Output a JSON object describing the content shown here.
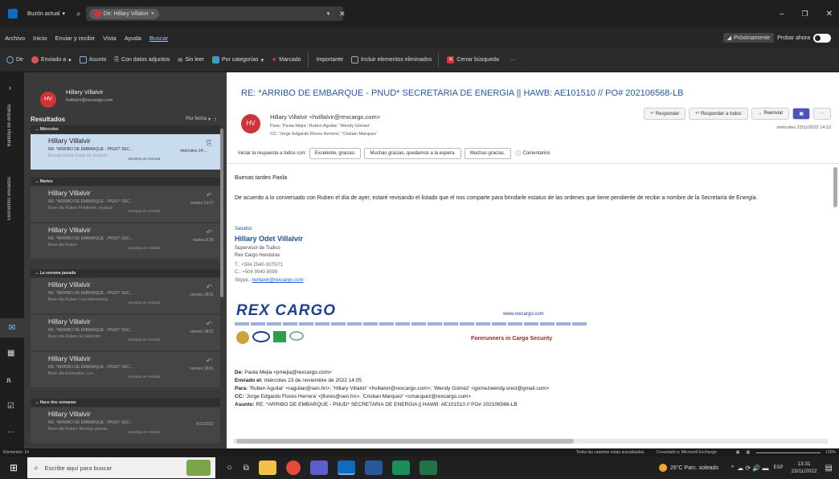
{
  "titlebar": {
    "mailbox": "Buzón actual",
    "search_tab": "De: Hillary Villalvir"
  },
  "menu": [
    "Archivo",
    "Inicio",
    "Enviar y recibir",
    "Vista",
    "Ayuda",
    "Buscar"
  ],
  "menu_right": {
    "soon": "Próximamente",
    "try": "Probar ahora"
  },
  "ribbon": [
    "De",
    "Enviado a",
    "Asunto",
    "Con datos adjuntos",
    "Sin leer",
    "Por categorías",
    "Marcado",
    "Importante",
    "Incluir elementos eliminados",
    "Cerrar búsqueda"
  ],
  "left_rail": {
    "label1": "Bandeja de entrada",
    "label2": "Elementos enviados"
  },
  "user": {
    "initials": "HV",
    "name": "Hillary Villalvir",
    "email": "hvillalvir@rexcargo.com"
  },
  "list": {
    "title": "Resultados",
    "sort": "Por fecha",
    "groups": {
      "g1": "Miércoles",
      "g2": "Martes",
      "g3": "La semana pasada",
      "g4": "Hace dos semanas"
    },
    "items": [
      {
        "from": "Hillary Villalvir",
        "subj": "RE: *ARRIBO DE EMBARQUE - PNUD* SEC...",
        "date": "miércoles 14:...",
        "prev": "Buenas tardes Paola De acuerdo",
        "folder": "Bandeja de entrada"
      },
      {
        "from": "Hillary Villalvir",
        "subj": "RE: *ARRIBO DE EMBARQUE - PNUD* SEC...",
        "date": "martes 13:07",
        "prev": "Buen día Ruben Pendiente, muchas",
        "folder": "Bandeja de entrada"
      },
      {
        "from": "Hillary Villalvir",
        "subj": "RE: *ARRIBO DE EMBARQUE - PNUD* SEC...",
        "date": "martes 8:25",
        "prev": "Buen día Ruben",
        "folder": "Bandeja de entrada"
      },
      {
        "from": "Hillary Villalvir",
        "subj": "RE: *ARRIBO DE EMBARQUE - PNUD* SEC...",
        "date": "viernes 18/11",
        "prev": "Buen día Ruben: Les informamos",
        "folder": "Bandeja de entrada"
      },
      {
        "from": "Hillary Villalvir",
        "subj": "RE: *ARRIBO DE EMBARQUE - PNUD* SEC...",
        "date": "viernes 18/11",
        "prev": "Buen día Ruben: En atención",
        "folder": "Bandeja de entrada"
      },
      {
        "from": "Hillary Villalvir",
        "subj": "RE: *ARRIBO DE EMBARQUE - PNUD* SEC...",
        "date": "viernes 18/11",
        "prev": "Buen día Estimados: Les",
        "folder": "Bandeja de entrada"
      },
      {
        "from": "Hillary Villalvir",
        "subj": "RE: *ARRIBO DE EMBARQUE - PNUD* SEC...",
        "date": "8/11/2022",
        "prev": "Buen día Ruben: Muchas gracias",
        "folder": "Bandeja de entrada"
      }
    ]
  },
  "message": {
    "subject": "RE: *ARRIBO DE EMBARQUE - PNUD* SECRETARIA DE ENERGIA || HAWB: AE101510 // PO# 202106568-LB",
    "from": "Hillary Villalvir <hvillalvir@rexcargo.com>",
    "to": "Para: 'Paola Mejia'; Ruben Aguilar; 'Wendy Gómez'",
    "cc": "CC: 'Jorge Edgardo Flores Herrera'; 'Cristian Marquez'",
    "datetime": "miércoles 23/11/2022 14:12",
    "buttons": {
      "reply": "Responder",
      "reply_all": "Responder a todos",
      "forward": "Reenviar"
    },
    "quick": {
      "label": "Iniciar la respuesta a todos con:",
      "q1": "Excelente, gracias.",
      "q2": "Muchas gracias, quedamos a la espera.",
      "q3": "Muchas gracias.",
      "comments": "Comentarios"
    },
    "greeting": "Buenas tardes Paola",
    "body": "De acuerdo a lo conversado con Ruben el día de ayer, estaré revisando el listado que el nos comparte para brindarle estatus de las ordenes que tiene pendiente de recibir a nombre de la Secretaría de Energía.",
    "sig": {
      "saludos": "Saludos",
      "name": "Hillary Odet Villalvir",
      "role": "Supervisor de Trafico",
      "company": "Rex Cargo Honduras",
      "tel": "T.: +504 2540-3070/71",
      "cel": "C.: +504 9940-8599",
      "skype_label": "Skype.:",
      "skype": "hvillalvir@rexcargo.com"
    },
    "logo": {
      "brand": "REX CARGO",
      "url": "www.rexcargo.com",
      "tagline": "Forerunners in Cargo Security"
    },
    "quoted": {
      "de_l": "De:",
      "de": "Paola Mejia <pmejia@rexcargo.com>",
      "env_l": "Enviado el:",
      "env": "miércoles 23 de noviembre de 2022 14:05",
      "para_l": "Para:",
      "para": "'Ruben Aguilar' <raguilar@sen.hn>; 'Hillary Villalvir' <hvillalvir@rexcargo.com>; 'Wendy Gómez' <gomezwendy.sreci@gmail.com>",
      "cc_l": "CC:",
      "cc": "'Jorge Edgardo Flores Herrera' <jflores@sen.hn>; 'Cristian Marquez' <cmarquez@rexcargo.com>",
      "asunto_l": "Asunto:",
      "asunto": "RE: *ARRIBO DE EMBARQUE - PNUD* SECRETARIA DE ENERGIA || HAWB: AE101510 // PO# 202106568-LB"
    }
  },
  "status": {
    "left": "Elementos: 14",
    "mid": "Todas las carpetas están actualizadas.",
    "conn": "Conectado a: Microsoft Exchange",
    "zoom": "100%"
  },
  "taskbar": {
    "search": "Escribe aquí para buscar",
    "weather": "26°C Parc. soleado",
    "lang": "ESP",
    "time": "13:31",
    "date": "23/11/2022"
  }
}
